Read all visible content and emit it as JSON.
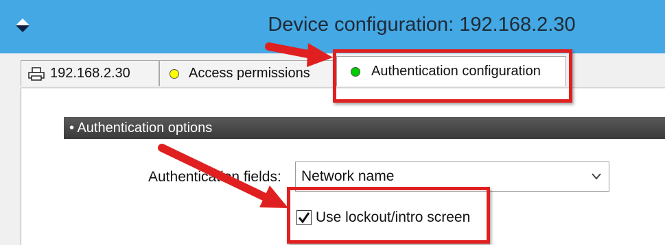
{
  "window": {
    "title": "Device configuration: 192.168.2.30",
    "title_bar_color": "#44a8e5"
  },
  "tabs": [
    {
      "label": "192.168.2.30",
      "icon": "printer-icon",
      "selected": false
    },
    {
      "label": "Access permissions",
      "icon": "yellow-status-dot-icon",
      "icon_color": "#ffff00",
      "selected": false
    },
    {
      "label": "Authentication configuration",
      "icon": "green-status-dot-icon",
      "icon_color": "#00cc00",
      "selected": true
    }
  ],
  "section": {
    "label": "• Authentication options"
  },
  "authentication_fields": {
    "label": "Authentication fields:",
    "value": "Network name"
  },
  "lockout": {
    "label": "Use lockout/intro screen",
    "checked": true
  },
  "annotations": {
    "highlight_color": "#e02020"
  }
}
